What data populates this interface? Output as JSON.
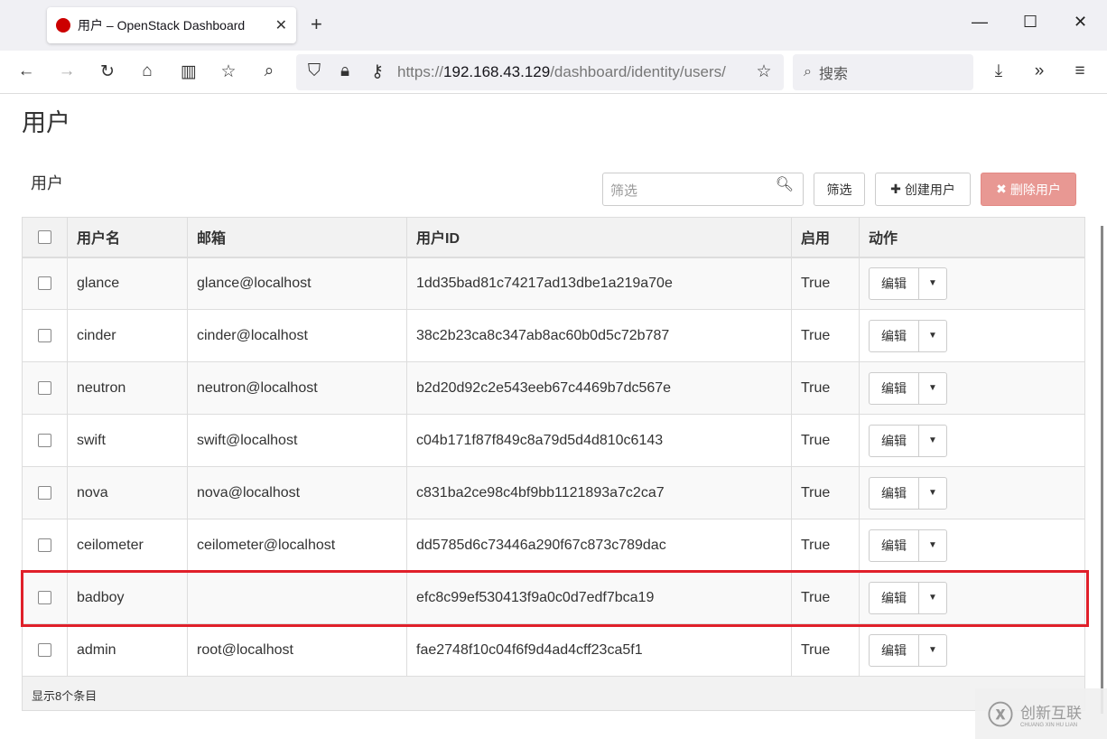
{
  "browser": {
    "tab_title": "用户 – OpenStack Dashboard",
    "url_prefix": "https://",
    "url_host": "192.168.43.129",
    "url_path": "/dashboard/identity/users/",
    "search_placeholder": "搜索"
  },
  "page": {
    "title": "用户",
    "section": "用户",
    "filter_placeholder": "筛选",
    "filter_button": "筛选",
    "create_button": "创建用户",
    "delete_button": "删除用户"
  },
  "table": {
    "headers": [
      "用户名",
      "邮箱",
      "用户ID",
      "启用",
      "动作"
    ],
    "rows": [
      {
        "name": "glance",
        "email": "glance@localhost",
        "id": "1dd35bad81c74217ad13dbe1a219a70e",
        "enabled": "True"
      },
      {
        "name": "cinder",
        "email": "cinder@localhost",
        "id": "38c2b23ca8c347ab8ac60b0d5c72b787",
        "enabled": "True"
      },
      {
        "name": "neutron",
        "email": "neutron@localhost",
        "id": "b2d20d92c2e543eeb67c4469b7dc567e",
        "enabled": "True"
      },
      {
        "name": "swift",
        "email": "swift@localhost",
        "id": "c04b171f87f849c8a79d5d4d810c6143",
        "enabled": "True"
      },
      {
        "name": "nova",
        "email": "nova@localhost",
        "id": "c831ba2ce98c4bf9bb1121893a7c2ca7",
        "enabled": "True"
      },
      {
        "name": "ceilometer",
        "email": "ceilometer@localhost",
        "id": "dd5785d6c73446a290f67c873c789dac",
        "enabled": "True"
      },
      {
        "name": "badboy",
        "email": "",
        "id": "efc8c99ef530413f9a0c0d7edf7bca19",
        "enabled": "True"
      },
      {
        "name": "admin",
        "email": "root@localhost",
        "id": "fae2748f10c04f6f9d4ad4cff23ca5f1",
        "enabled": "True"
      }
    ],
    "edit_label": "编辑",
    "footer": "显示8个条目"
  },
  "watermark": {
    "name": "创新互联",
    "sub": "CHUANG XIN HU LIAN"
  },
  "colors": {
    "highlight": "#e0202a",
    "delete": "#e89893"
  }
}
